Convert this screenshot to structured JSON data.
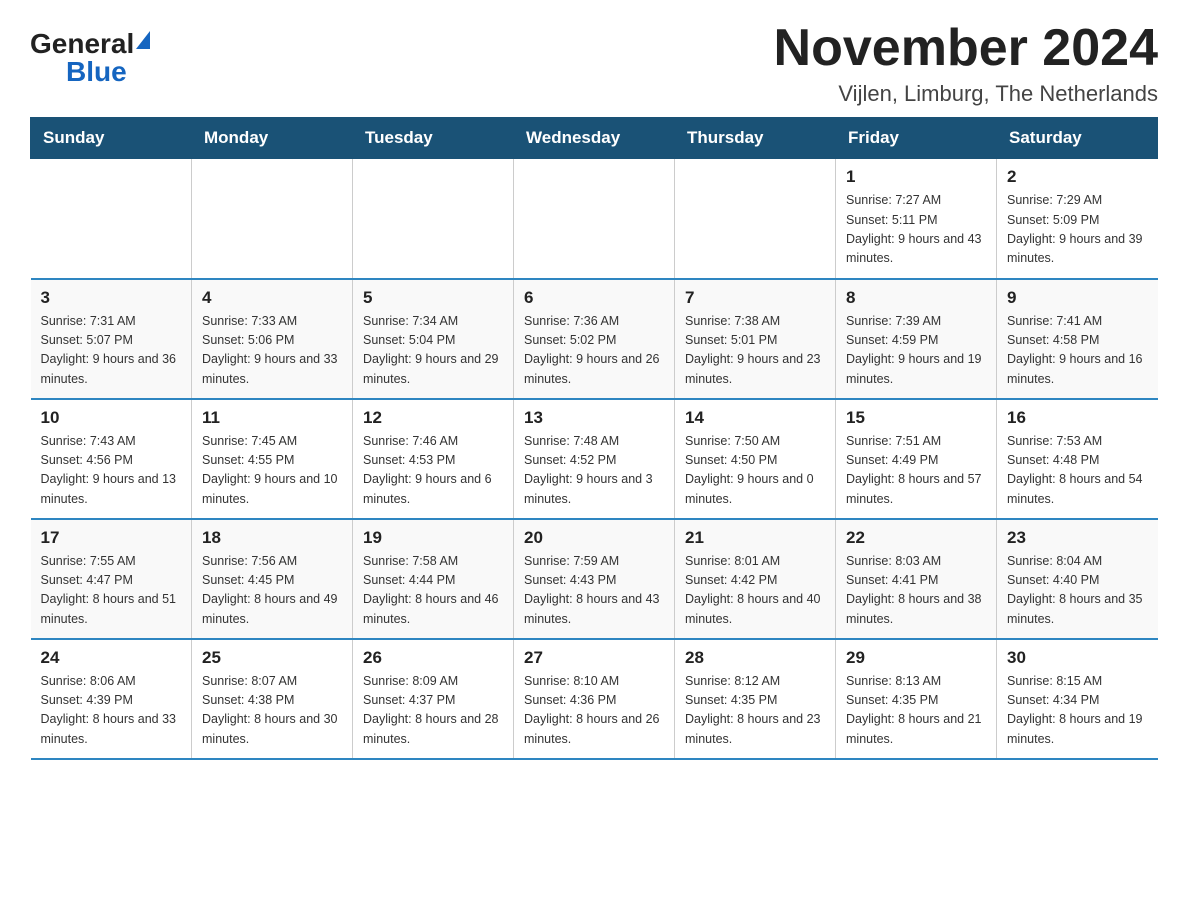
{
  "logo": {
    "general": "General",
    "blue": "Blue"
  },
  "title": "November 2024",
  "location": "Vijlen, Limburg, The Netherlands",
  "weekdays": [
    "Sunday",
    "Monday",
    "Tuesday",
    "Wednesday",
    "Thursday",
    "Friday",
    "Saturday"
  ],
  "rows": [
    [
      {
        "day": "",
        "info": ""
      },
      {
        "day": "",
        "info": ""
      },
      {
        "day": "",
        "info": ""
      },
      {
        "day": "",
        "info": ""
      },
      {
        "day": "",
        "info": ""
      },
      {
        "day": "1",
        "info": "Sunrise: 7:27 AM\nSunset: 5:11 PM\nDaylight: 9 hours and 43 minutes."
      },
      {
        "day": "2",
        "info": "Sunrise: 7:29 AM\nSunset: 5:09 PM\nDaylight: 9 hours and 39 minutes."
      }
    ],
    [
      {
        "day": "3",
        "info": "Sunrise: 7:31 AM\nSunset: 5:07 PM\nDaylight: 9 hours and 36 minutes."
      },
      {
        "day": "4",
        "info": "Sunrise: 7:33 AM\nSunset: 5:06 PM\nDaylight: 9 hours and 33 minutes."
      },
      {
        "day": "5",
        "info": "Sunrise: 7:34 AM\nSunset: 5:04 PM\nDaylight: 9 hours and 29 minutes."
      },
      {
        "day": "6",
        "info": "Sunrise: 7:36 AM\nSunset: 5:02 PM\nDaylight: 9 hours and 26 minutes."
      },
      {
        "day": "7",
        "info": "Sunrise: 7:38 AM\nSunset: 5:01 PM\nDaylight: 9 hours and 23 minutes."
      },
      {
        "day": "8",
        "info": "Sunrise: 7:39 AM\nSunset: 4:59 PM\nDaylight: 9 hours and 19 minutes."
      },
      {
        "day": "9",
        "info": "Sunrise: 7:41 AM\nSunset: 4:58 PM\nDaylight: 9 hours and 16 minutes."
      }
    ],
    [
      {
        "day": "10",
        "info": "Sunrise: 7:43 AM\nSunset: 4:56 PM\nDaylight: 9 hours and 13 minutes."
      },
      {
        "day": "11",
        "info": "Sunrise: 7:45 AM\nSunset: 4:55 PM\nDaylight: 9 hours and 10 minutes."
      },
      {
        "day": "12",
        "info": "Sunrise: 7:46 AM\nSunset: 4:53 PM\nDaylight: 9 hours and 6 minutes."
      },
      {
        "day": "13",
        "info": "Sunrise: 7:48 AM\nSunset: 4:52 PM\nDaylight: 9 hours and 3 minutes."
      },
      {
        "day": "14",
        "info": "Sunrise: 7:50 AM\nSunset: 4:50 PM\nDaylight: 9 hours and 0 minutes."
      },
      {
        "day": "15",
        "info": "Sunrise: 7:51 AM\nSunset: 4:49 PM\nDaylight: 8 hours and 57 minutes."
      },
      {
        "day": "16",
        "info": "Sunrise: 7:53 AM\nSunset: 4:48 PM\nDaylight: 8 hours and 54 minutes."
      }
    ],
    [
      {
        "day": "17",
        "info": "Sunrise: 7:55 AM\nSunset: 4:47 PM\nDaylight: 8 hours and 51 minutes."
      },
      {
        "day": "18",
        "info": "Sunrise: 7:56 AM\nSunset: 4:45 PM\nDaylight: 8 hours and 49 minutes."
      },
      {
        "day": "19",
        "info": "Sunrise: 7:58 AM\nSunset: 4:44 PM\nDaylight: 8 hours and 46 minutes."
      },
      {
        "day": "20",
        "info": "Sunrise: 7:59 AM\nSunset: 4:43 PM\nDaylight: 8 hours and 43 minutes."
      },
      {
        "day": "21",
        "info": "Sunrise: 8:01 AM\nSunset: 4:42 PM\nDaylight: 8 hours and 40 minutes."
      },
      {
        "day": "22",
        "info": "Sunrise: 8:03 AM\nSunset: 4:41 PM\nDaylight: 8 hours and 38 minutes."
      },
      {
        "day": "23",
        "info": "Sunrise: 8:04 AM\nSunset: 4:40 PM\nDaylight: 8 hours and 35 minutes."
      }
    ],
    [
      {
        "day": "24",
        "info": "Sunrise: 8:06 AM\nSunset: 4:39 PM\nDaylight: 8 hours and 33 minutes."
      },
      {
        "day": "25",
        "info": "Sunrise: 8:07 AM\nSunset: 4:38 PM\nDaylight: 8 hours and 30 minutes."
      },
      {
        "day": "26",
        "info": "Sunrise: 8:09 AM\nSunset: 4:37 PM\nDaylight: 8 hours and 28 minutes."
      },
      {
        "day": "27",
        "info": "Sunrise: 8:10 AM\nSunset: 4:36 PM\nDaylight: 8 hours and 26 minutes."
      },
      {
        "day": "28",
        "info": "Sunrise: 8:12 AM\nSunset: 4:35 PM\nDaylight: 8 hours and 23 minutes."
      },
      {
        "day": "29",
        "info": "Sunrise: 8:13 AM\nSunset: 4:35 PM\nDaylight: 8 hours and 21 minutes."
      },
      {
        "day": "30",
        "info": "Sunrise: 8:15 AM\nSunset: 4:34 PM\nDaylight: 8 hours and 19 minutes."
      }
    ]
  ]
}
